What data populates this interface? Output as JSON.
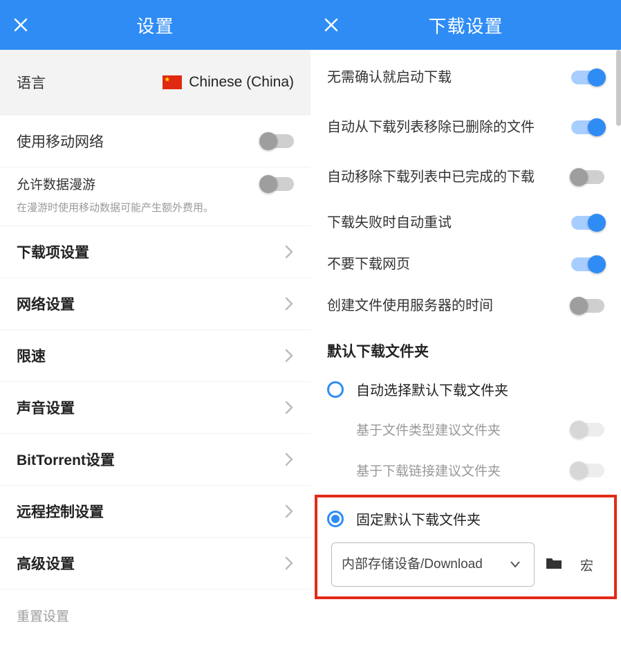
{
  "left": {
    "title": "设置",
    "language": {
      "label": "语言",
      "value": "Chinese (China)"
    },
    "mobile": {
      "label": "使用移动网络",
      "on": false
    },
    "roaming": {
      "label": "允许数据漫游",
      "on": false,
      "hint": "在漫游时使用移动数据可能产生额外费用。"
    },
    "nav": [
      {
        "key": "downloads",
        "label": "下载项设置"
      },
      {
        "key": "network",
        "label": "网络设置"
      },
      {
        "key": "speed",
        "label": "限速"
      },
      {
        "key": "sound",
        "label": "声音设置"
      },
      {
        "key": "bittorrent",
        "label": "BitTorrent设置"
      },
      {
        "key": "remote",
        "label": "远程控制设置"
      },
      {
        "key": "advanced",
        "label": "高级设置"
      }
    ],
    "reset": "重置设置"
  },
  "right": {
    "title": "下载设置",
    "toggles": [
      {
        "key": "start-no-confirm",
        "label": "无需确认就启动下载",
        "on": true
      },
      {
        "key": "auto-remove-deleted",
        "label": "自动从下载列表移除已删除的文件",
        "on": true
      },
      {
        "key": "auto-remove-completed",
        "label": "自动移除下载列表中已完成的下载",
        "on": false
      },
      {
        "key": "auto-retry",
        "label": "下载失败时自动重试",
        "on": true
      },
      {
        "key": "no-download-webpage",
        "label": "不要下载网页",
        "on": true
      },
      {
        "key": "server-time",
        "label": "创建文件使用服务器的时间",
        "on": false
      }
    ],
    "folder": {
      "section_title": "默认下载文件夹",
      "auto": {
        "label": "自动选择默认下载文件夹",
        "selected": false
      },
      "by_type": {
        "label": "基于文件类型建议文件夹",
        "on": false
      },
      "by_link": {
        "label": "基于下载链接建议文件夹",
        "on": false
      },
      "fixed": {
        "label": "固定默认下载文件夹",
        "selected": true
      },
      "path": "内部存储设备/Download",
      "macro": "宏"
    }
  }
}
